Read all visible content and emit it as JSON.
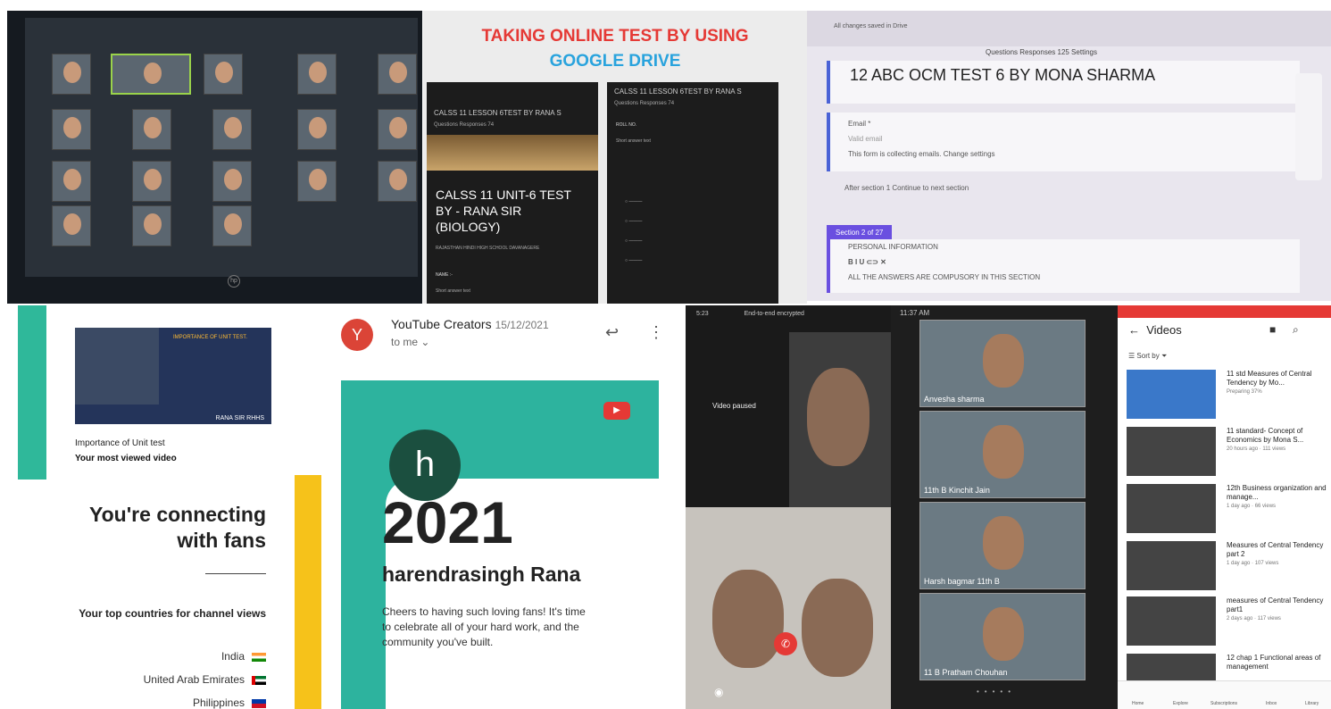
{
  "drive": {
    "title1": "TAKING  ONLINE TEST BY USING",
    "title2": "GOOGLE DRIVE",
    "form_a_header": "CALSS 11 LESSON 6TEST BY RANA S",
    "form_a_tabs": "Questions   Responses  74",
    "form_a_title": "CALSS 11 UNIT-6 TEST BY - RANA SIR (BIOLOGY)",
    "school": "RAJASTHAN HINDI HIGH SCHOOL DAVANAGERE",
    "name_field": "NAME :-",
    "short_answer": "Short answer text",
    "form_b_header": "CALSS 11 LESSON 6TEST BY RANA S",
    "roll_no": "ROLL NO."
  },
  "form": {
    "toolbar": "All changes saved in Drive",
    "tabs": "Questions   Responses  125   Settings",
    "title": "12 ABC  OCM TEST 6 BY  MONA SHARMA",
    "email_label": "Email *",
    "email_placeholder": "Valid email",
    "collecting": "This form is collecting emails.  Change settings",
    "after": "After section 1    Continue to next section",
    "section": "Section 2 of 27",
    "personal": "PERSONAL INFORMATION",
    "compulsory": "ALL THE ANSWERS ARE COMPUSORY IN THIS SECTION"
  },
  "unit": {
    "thumb_title": "IMPORTANCE OF UNIT TEST.",
    "caption": "RANA SIR  RHHS",
    "line1": "Importance of Unit test",
    "line2": "Your most viewed video",
    "heading": "You're connecting with fans",
    "top_countries": "Your top countries for channel views",
    "countries": [
      "India",
      "United Arab Emirates",
      "Philippines"
    ]
  },
  "email": {
    "avatar": "Y",
    "sender": "YouTube Creators",
    "date": "15/12/2021",
    "to": "to me",
    "h": "h",
    "year": "2021",
    "name": "harendrasingh Rana",
    "message": "Cheers to having such loving fans! It's time to celebrate all of your hard work, and the community you've built."
  },
  "call": {
    "status": "5:23",
    "encrypted": "End-to-end encrypted",
    "paused": "Video paused"
  },
  "meet": {
    "time": "11:37 AM",
    "tiles": [
      "Anvesha sharma",
      "11th B Kinchit Jain",
      "Harsh bagmar 11th B",
      "11 B Pratham Chouhan"
    ]
  },
  "videos": {
    "title": "Videos",
    "sort": "Sort by",
    "items": [
      {
        "title": "11 std Measures of Central Tendency by Mo...",
        "meta": "Preparing 37%"
      },
      {
        "title": "11 standard- Concept of Economics by Mona S...",
        "meta": "20 hours ago · 111 views"
      },
      {
        "title": "12th Business organization and manage...",
        "meta": "1 day ago · 66 views"
      },
      {
        "title": "Measures of Central Tendency part 2",
        "meta": "1 day ago · 107 views"
      },
      {
        "title": "measures of Central Tendency part1",
        "meta": "2 days ago · 117 views"
      },
      {
        "title": "12 chap 1 Functional areas of management",
        "meta": ""
      }
    ],
    "nav": [
      "Home",
      "Explore",
      "Subscriptions",
      "Inbox",
      "Library"
    ]
  }
}
